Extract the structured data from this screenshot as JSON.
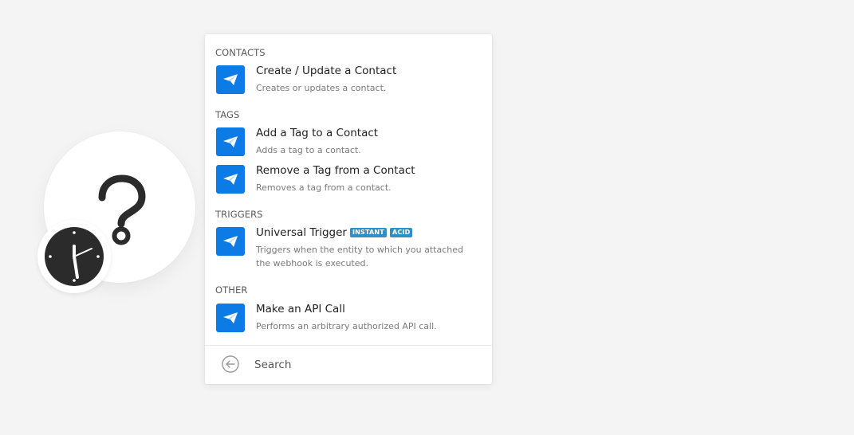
{
  "theme": {
    "app_icon_color": "#0d7be6",
    "badge_color": "#2f8fc6",
    "canvas_background": "#f4f4f4"
  },
  "canvas": {
    "module_icon": "question-mark-icon",
    "schedule_icon": "clock-icon"
  },
  "picker": {
    "sections": [
      {
        "header": "CONTACTS",
        "items": [
          {
            "icon": "paper-plane-icon",
            "title": "Create / Update a Contact",
            "description": "Creates or updates a contact."
          }
        ]
      },
      {
        "header": "TAGS",
        "items": [
          {
            "icon": "paper-plane-icon",
            "title": "Add a Tag to a Contact",
            "description": "Adds a tag to a contact."
          },
          {
            "icon": "paper-plane-icon",
            "title": "Remove a Tag from a Contact",
            "description": "Removes a tag from a contact."
          }
        ]
      },
      {
        "header": "TRIGGERS",
        "items": [
          {
            "icon": "paper-plane-icon",
            "title": "Universal Trigger",
            "badges": [
              "INSTANT",
              "ACID"
            ],
            "description": "Triggers when the entity to which you attached the webhook is executed."
          }
        ]
      },
      {
        "header": "OTHER",
        "items": [
          {
            "icon": "paper-plane-icon",
            "title": "Make an API Call",
            "description": "Performs an arbitrary authorized API call."
          }
        ]
      }
    ],
    "footer": {
      "back_icon": "arrow-left-circle-icon",
      "search_placeholder": "Search",
      "search_value": ""
    }
  }
}
